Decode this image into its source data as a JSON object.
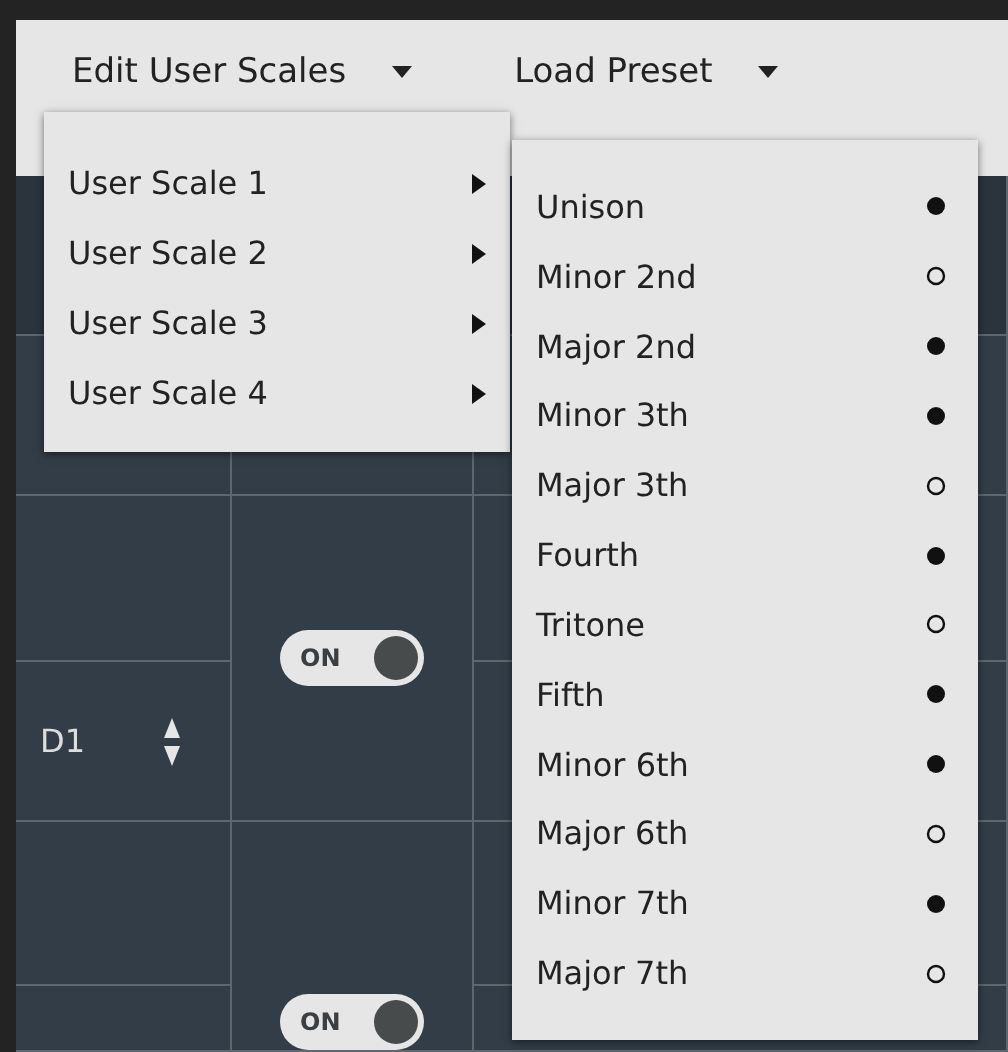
{
  "menu_bar": [
    {
      "label": "Edit User Scales"
    },
    {
      "label": "Load Preset"
    }
  ],
  "user_scales_menu": [
    {
      "label": "User Scale 1"
    },
    {
      "label": "User Scale 2"
    },
    {
      "label": "User Scale 3"
    },
    {
      "label": "User Scale 4"
    }
  ],
  "intervals_submenu": [
    {
      "label": "Unison",
      "checked": true
    },
    {
      "label": "Minor 2nd",
      "checked": false
    },
    {
      "label": "Major 2nd",
      "checked": true
    },
    {
      "label": "Minor 3th",
      "checked": true
    },
    {
      "label": "Major 3th",
      "checked": false
    },
    {
      "label": "Fourth",
      "checked": true
    },
    {
      "label": "Tritone",
      "checked": false
    },
    {
      "label": "Fifth",
      "checked": true
    },
    {
      "label": "Minor 6th",
      "checked": true
    },
    {
      "label": "Major 6th",
      "checked": false
    },
    {
      "label": "Minor 7th",
      "checked": true
    },
    {
      "label": "Major 7th",
      "checked": false
    }
  ],
  "grid": {
    "note": "D1",
    "toggles": [
      {
        "label": "ON",
        "on": true
      },
      {
        "label": "ON",
        "on": true
      }
    ]
  }
}
